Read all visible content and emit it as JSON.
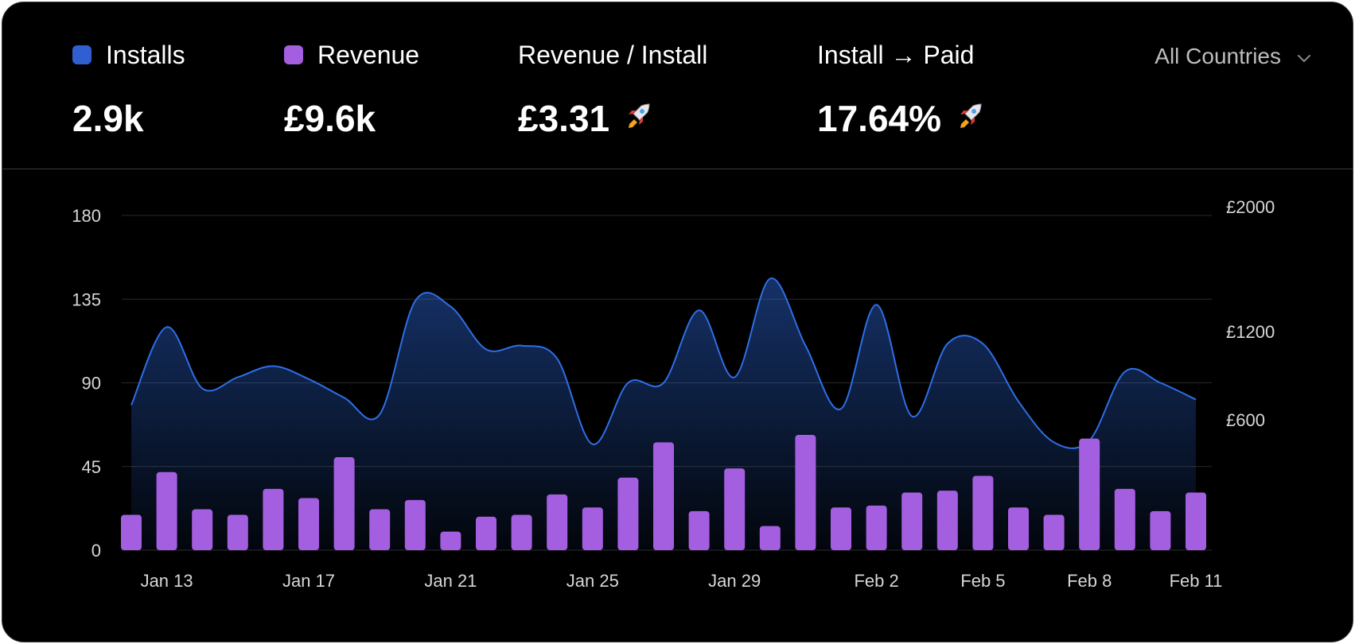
{
  "metrics": [
    {
      "label": "Installs",
      "value": "2.9k",
      "color": "#2f5fd0",
      "has_rocket": false
    },
    {
      "label": "Revenue",
      "value": "£9.6k",
      "color": "#a45ee0",
      "has_rocket": false
    },
    {
      "label": "Revenue / Install",
      "value": "£3.31",
      "has_rocket": true
    },
    {
      "label": "Install → Paid",
      "value": "17.64%",
      "has_rocket": true
    }
  ],
  "filter": {
    "selected": "All Countries"
  },
  "chart_data": {
    "type": "bar+area",
    "x_tick_labels": [
      "Jan 13",
      "Jan 17",
      "Jan 21",
      "Jan 25",
      "Jan 29",
      "Feb 2",
      "Feb 5",
      "Feb 8",
      "Feb 11"
    ],
    "left_axis": {
      "ticks": [
        "0",
        "45",
        "90",
        "135",
        "180"
      ],
      "ylim": [
        0,
        180
      ]
    },
    "right_axis": {
      "ticks": [
        "£600",
        "£1200",
        "£2000"
      ]
    },
    "grid": true,
    "series": [
      {
        "name": "Installs",
        "type": "area",
        "axis": "left",
        "color": "#2f6ee6",
        "values": [
          78,
          120,
          87,
          93,
          99,
          92,
          82,
          73,
          134,
          131,
          108,
          110,
          103,
          57,
          90,
          90,
          129,
          93,
          146,
          110,
          76,
          132,
          72,
          111,
          111,
          80,
          58,
          59,
          96,
          90,
          81
        ]
      },
      {
        "name": "Revenue",
        "type": "bar",
        "axis": "left",
        "color": "#a45ee0",
        "values": [
          19,
          42,
          22,
          19,
          33,
          28,
          50,
          22,
          27,
          10,
          18,
          19,
          30,
          23,
          39,
          58,
          21,
          44,
          13,
          62,
          23,
          24,
          31,
          32,
          40,
          23,
          19,
          60,
          33,
          21,
          31
        ]
      }
    ]
  }
}
